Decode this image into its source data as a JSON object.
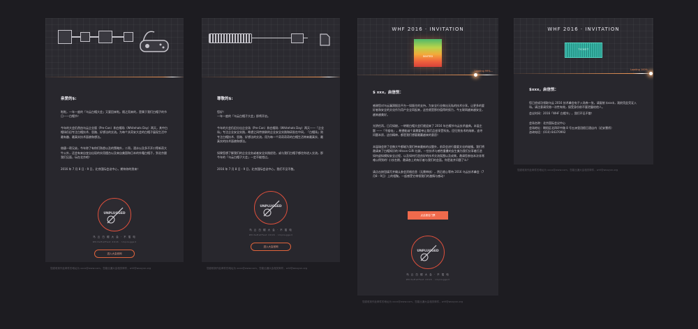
{
  "cards": [
    {
      "greeting": "亲爱的$:",
      "paras": [
        "啦啦，一年一度的「乌云白帽大会」又要回来啦。随之而来的，是属于我们白帽子的节日——白帽节！",
        "今年的大会仍然由乌云企业版（Pre-Con）和白帽场（Whitehats Day）两天，其中白帽场仍旧专注白帽技术、思路、好想法的交流。为每个关奇安大会的白帽子展现生活中最有趣、最真实技术面貌和想法。",
        "借唐一帮兄弟，今年除了有你们熟悉以及的策略外，二哥，酒水以及多不开口等新奇大牛公外，还会有来自宜自出现的实用擂台以及来自美国和日本的外籍白帽子，到北京跟我们见面，玩在北京吧！",
        "2016 年 7 月 8 日 - 9 日，北京国际会议中心，期待你的到来！"
      ],
      "logo_text": "UNPLUGGED",
      "logo_caption": "乌 云 白 帽 大 会 · 不 插 电",
      "logo_sub": "WhiteHatFest 2016 · Unplugged",
      "button_label": "进入大会官网",
      "footer": "您越收到作此邮件的地址为 xxxx@www.com，您能出通大会相关邮件，whf@wooyun.org"
    },
    {
      "greeting": "尊敬的$:",
      "paras": [
        "您好！\n一年一度的「乌云白帽子大会」即将开启。",
        "今年的大会仍旧分出企业场（Pre-Con）和白帽场（Whitehats Day）两天——「企业场」专注企业安全实践，希望之间传统联的企业安全实践和研发在中间，「白帽场」则专注白帽技术、思路、好想法的交流，用为每一个奇奇奇奇的白帽生活带来最真实、最真实的技术面貌和想法。",
        "如果您想了解我们的企业业务或者安全实践经验，或与我们白帽子都往你进入交流，那今年的「乌云白帽子大会」一定不能错过。",
        "2016 年 7 月 8 日 - 9 日，北京国际会议中心，我们不见不散。"
      ],
      "logo_text": "UNPLUGGED",
      "logo_caption": "乌 云 白 帽 大 会 · 不 插 电",
      "logo_sub": "WhiteHatFest 2016 · Unplugged",
      "button_label": "进入大会官网",
      "footer": "您越收到作此邮件的地址为 xxxx@www.com，您能出通大会相关邮件，whf@wooyun.org"
    },
    {
      "header_title": "WHF 2016 · INVITATION",
      "ticket_label": "INVITED",
      "loading": "Loading 99%...",
      "greeting": "$ xxx，启信悦：",
      "paras": [
        "感谢您对乌云漏洞报告平台一如既往的支持，为安全行业做出无私的技术分享。让更多的要好者和安全的文化作为用产业全同起来，这些就是那份值得的努力，今五联网越来越安全，越来越美好。",
        "光阴任再，日月如梭，一转眼白帽大会们就迎来了 2016 年白帽节乌云技术盛典。本届主题 ——「不插电」，希望能诚个真需要带让我们品尝享受科技。回归到技术的纯粹，追寻问题本质，这份精神，都是我们想要最赢越来的意愿！",
        "本届瑞会除了会携大牛都磁为我们带来最新的议题外，前奇会进行重要文化的碰撞。我们将邀请来了白帽知识的 Hitcon GiRl 社群，一些技术与感性重叠的女生美为我们分享着打造如何虚拟模拟安全过程，以及如何打造良好的技术交流氛围以及成果。邀请您参加本次非常难以得到的! 小技名期，邀请各上的有识者与我们的会面。你是谁并问题了么？",
        "请点击按钮填写并确认参会资格信息（无需审核），然后就心等待 2016 乌云技术峰会（7月8 - 9日）上的相聚。一起感受它带领我们的激情与感动！"
      ],
      "button_label": "点此报名门票",
      "logo_text": "UNPLUGGED",
      "logo_caption": "乌 云 白 帽 大 会 · 不 插 电",
      "logo_sub": "WhiteHatFest 2016 · Unplugged",
      "footer": "您越收到作此邮件的地址为 xxxx@www.com，您能出通大会相关邮件，whf@wooyun.org"
    },
    {
      "header_title": "WHF 2016 · INVITATION",
      "ticket_label": "TICKET",
      "loading": "Loading 100%",
      "greeting": "$xxx，启信悦：",
      "paras": [
        "您已经成功领取乌云 2016 技术峰会电子入场券一张，请复制 $xxx$，观前凭此凭证入场。请注意请凭借一次性有效，接受身份前不要泄露给他人。",
        "会议时间：2016「WHF 白帽节」，我们不见不散！"
      ],
      "details": [
        "会场名称：北京国际会议中心",
        "会场地址：朝阳区北四环中路 8 号五洲皇冠假日酒店内（近安慧桥）",
        "咨询电话：(010) 84370992"
      ],
      "footer": "您越收到作此邮件的地址为 xxxx@www.com，您能出通大会相关邮件，whf@wooyun.org"
    }
  ],
  "colors": {
    "background": "#1d1c21",
    "card": "#28272d",
    "accent": "#f06a4c",
    "ring": "#e0503c"
  }
}
